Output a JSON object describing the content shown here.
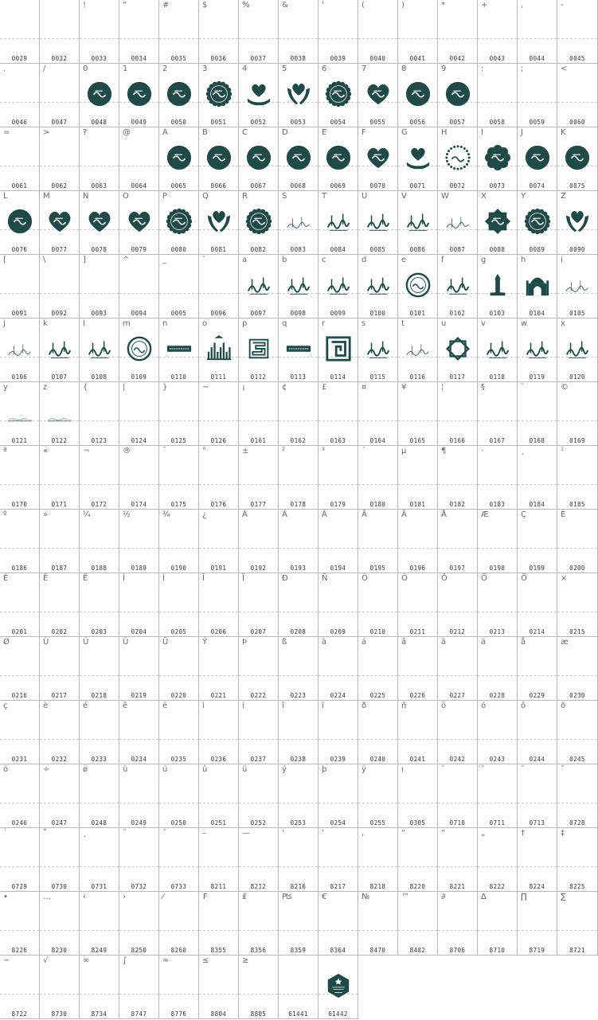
{
  "colors": {
    "glyph": "#1f4a47",
    "border": "#b8b8b8",
    "baseline": "#c8c8c8"
  },
  "cells": [
    {
      "ch": "",
      "code": "0029"
    },
    {
      "ch": "",
      "code": "0032"
    },
    {
      "ch": "!",
      "code": "0033"
    },
    {
      "ch": "\"",
      "code": "0034"
    },
    {
      "ch": "#",
      "code": "0035"
    },
    {
      "ch": "$",
      "code": "0036"
    },
    {
      "ch": "%",
      "code": "0037"
    },
    {
      "ch": "&",
      "code": "0038"
    },
    {
      "ch": "'",
      "code": "0039"
    },
    {
      "ch": "(",
      "code": "0040"
    },
    {
      "ch": ")",
      "code": "0041"
    },
    {
      "ch": "*",
      "code": "0042"
    },
    {
      "ch": "+",
      "code": "0043"
    },
    {
      "ch": ",",
      "code": "0044"
    },
    {
      "ch": "-",
      "code": "0045"
    },
    {
      "ch": ".",
      "code": "0046"
    },
    {
      "ch": "/",
      "code": "0047"
    },
    {
      "ch": "0",
      "code": "0048",
      "icon": "circle"
    },
    {
      "ch": "1",
      "code": "0049",
      "icon": "circle"
    },
    {
      "ch": "2",
      "code": "0050",
      "icon": "circle"
    },
    {
      "ch": "3",
      "code": "0051",
      "icon": "rosette"
    },
    {
      "ch": "4",
      "code": "0052",
      "icon": "hand-heart"
    },
    {
      "ch": "5",
      "code": "0053",
      "icon": "hands-heart"
    },
    {
      "ch": "6",
      "code": "0054",
      "icon": "rosette"
    },
    {
      "ch": "7",
      "code": "0055",
      "icon": "heart"
    },
    {
      "ch": "8",
      "code": "0056",
      "icon": "circle"
    },
    {
      "ch": "9",
      "code": "0057",
      "icon": "circle"
    },
    {
      "ch": ":",
      "code": "0058"
    },
    {
      "ch": ";",
      "code": "0059"
    },
    {
      "ch": "<",
      "code": "0060"
    },
    {
      "ch": "=",
      "code": "0061"
    },
    {
      "ch": ">",
      "code": "0062"
    },
    {
      "ch": "?",
      "code": "0063"
    },
    {
      "ch": "@",
      "code": "0064"
    },
    {
      "ch": "A",
      "code": "0065",
      "icon": "circle"
    },
    {
      "ch": "B",
      "code": "0066",
      "icon": "circle"
    },
    {
      "ch": "C",
      "code": "0067",
      "icon": "circle"
    },
    {
      "ch": "D",
      "code": "0068",
      "icon": "circle"
    },
    {
      "ch": "E",
      "code": "0069",
      "icon": "circle"
    },
    {
      "ch": "F",
      "code": "0070",
      "icon": "heart"
    },
    {
      "ch": "G",
      "code": "0071",
      "icon": "hand-heart"
    },
    {
      "ch": "H",
      "code": "0072",
      "icon": "dotted-circle"
    },
    {
      "ch": "I",
      "code": "0073",
      "icon": "flower"
    },
    {
      "ch": "J",
      "code": "0074",
      "icon": "circle"
    },
    {
      "ch": "K",
      "code": "0075",
      "icon": "circle"
    },
    {
      "ch": "L",
      "code": "0076",
      "icon": "circle"
    },
    {
      "ch": "M",
      "code": "0077",
      "icon": "heart"
    },
    {
      "ch": "N",
      "code": "0078",
      "icon": "heart"
    },
    {
      "ch": "O",
      "code": "0079",
      "icon": "heart"
    },
    {
      "ch": "P",
      "code": "0080",
      "icon": "rosette"
    },
    {
      "ch": "Q",
      "code": "0081",
      "icon": "hands-heart"
    },
    {
      "ch": "R",
      "code": "0082",
      "icon": "rosette"
    },
    {
      "ch": "S",
      "code": "0083",
      "icon": "script-light"
    },
    {
      "ch": "T",
      "code": "0084",
      "icon": "script"
    },
    {
      "ch": "U",
      "code": "0085",
      "icon": "script"
    },
    {
      "ch": "V",
      "code": "0086",
      "icon": "script"
    },
    {
      "ch": "W",
      "code": "0087",
      "icon": "script-light"
    },
    {
      "ch": "X",
      "code": "0088",
      "icon": "star8"
    },
    {
      "ch": "Y",
      "code": "0089",
      "icon": "rosette"
    },
    {
      "ch": "Z",
      "code": "0090",
      "icon": "hands-heart"
    },
    {
      "ch": "[",
      "code": "0091"
    },
    {
      "ch": "\\",
      "code": "0092"
    },
    {
      "ch": "]",
      "code": "0093"
    },
    {
      "ch": "^",
      "code": "0094"
    },
    {
      "ch": "_",
      "code": "0095"
    },
    {
      "ch": "`",
      "code": "0096"
    },
    {
      "ch": "a",
      "code": "0097",
      "icon": "script"
    },
    {
      "ch": "b",
      "code": "0098",
      "icon": "script"
    },
    {
      "ch": "c",
      "code": "0099",
      "icon": "script"
    },
    {
      "ch": "d",
      "code": "0100",
      "icon": "script"
    },
    {
      "ch": "e",
      "code": "0101",
      "icon": "ring"
    },
    {
      "ch": "f",
      "code": "0102",
      "icon": "script"
    },
    {
      "ch": "g",
      "code": "0103",
      "icon": "minaret"
    },
    {
      "ch": "h",
      "code": "0104",
      "icon": "mosque"
    },
    {
      "ch": "i",
      "code": "0105",
      "icon": "script-light"
    },
    {
      "ch": "j",
      "code": "0106",
      "icon": "script-light"
    },
    {
      "ch": "k",
      "code": "0107",
      "icon": "script"
    },
    {
      "ch": "l",
      "code": "0108",
      "icon": "script"
    },
    {
      "ch": "m",
      "code": "0109",
      "icon": "ring"
    },
    {
      "ch": "n",
      "code": "0110",
      "icon": "banner"
    },
    {
      "ch": "o",
      "code": "0111",
      "icon": "kufic-bars"
    },
    {
      "ch": "p",
      "code": "0112",
      "icon": "kufic-square"
    },
    {
      "ch": "q",
      "code": "0113",
      "icon": "banner"
    },
    {
      "ch": "r",
      "code": "0114",
      "icon": "kufic-maze"
    },
    {
      "ch": "s",
      "code": "0115",
      "icon": "script"
    },
    {
      "ch": "t",
      "code": "0116",
      "icon": "script-light"
    },
    {
      "ch": "u",
      "code": "0117",
      "icon": "star-frame"
    },
    {
      "ch": "v",
      "code": "0118",
      "icon": "script"
    },
    {
      "ch": "w",
      "code": "0119",
      "icon": "script"
    },
    {
      "ch": "x",
      "code": "0120",
      "icon": "script"
    },
    {
      "ch": "y",
      "code": "0121",
      "icon": "faint"
    },
    {
      "ch": "z",
      "code": "0122",
      "icon": "faint"
    },
    {
      "ch": "{",
      "code": "0123"
    },
    {
      "ch": "|",
      "code": "0124"
    },
    {
      "ch": "}",
      "code": "0125"
    },
    {
      "ch": "~",
      "code": "0126"
    },
    {
      "ch": "¡",
      "code": "0161"
    },
    {
      "ch": "¢",
      "code": "0162"
    },
    {
      "ch": "£",
      "code": "0163"
    },
    {
      "ch": "¤",
      "code": "0164"
    },
    {
      "ch": "¥",
      "code": "0165"
    },
    {
      "ch": "¦",
      "code": "0166"
    },
    {
      "ch": "§",
      "code": "0167"
    },
    {
      "ch": "¨",
      "code": "0168"
    },
    {
      "ch": "©",
      "code": "0169"
    },
    {
      "ch": "ª",
      "code": "0170"
    },
    {
      "ch": "«",
      "code": "0171"
    },
    {
      "ch": "¬",
      "code": "0172"
    },
    {
      "ch": "®",
      "code": "0174"
    },
    {
      "ch": "¯",
      "code": "0175"
    },
    {
      "ch": "°",
      "code": "0176"
    },
    {
      "ch": "±",
      "code": "0177"
    },
    {
      "ch": "²",
      "code": "0178"
    },
    {
      "ch": "³",
      "code": "0179"
    },
    {
      "ch": "´",
      "code": "0180"
    },
    {
      "ch": "µ",
      "code": "0181"
    },
    {
      "ch": "¶",
      "code": "0182"
    },
    {
      "ch": "·",
      "code": "0183"
    },
    {
      "ch": "¸",
      "code": "0184"
    },
    {
      "ch": "¹",
      "code": "0185"
    },
    {
      "ch": "º",
      "code": "0186"
    },
    {
      "ch": "»",
      "code": "0187"
    },
    {
      "ch": "¼",
      "code": "0188"
    },
    {
      "ch": "½",
      "code": "0189"
    },
    {
      "ch": "¾",
      "code": "0190"
    },
    {
      "ch": "¿",
      "code": "0191"
    },
    {
      "ch": "À",
      "code": "0192"
    },
    {
      "ch": "Á",
      "code": "0193"
    },
    {
      "ch": "Â",
      "code": "0194"
    },
    {
      "ch": "Ã",
      "code": "0195"
    },
    {
      "ch": "Ä",
      "code": "0196"
    },
    {
      "ch": "Å",
      "code": "0197"
    },
    {
      "ch": "Æ",
      "code": "0198"
    },
    {
      "ch": "Ç",
      "code": "0199"
    },
    {
      "ch": "È",
      "code": "0200"
    },
    {
      "ch": "É",
      "code": "0201"
    },
    {
      "ch": "Ê",
      "code": "0202"
    },
    {
      "ch": "Ë",
      "code": "0203"
    },
    {
      "ch": "Ì",
      "code": "0204"
    },
    {
      "ch": "Í",
      "code": "0205"
    },
    {
      "ch": "Î",
      "code": "0206"
    },
    {
      "ch": "Ï",
      "code": "0207"
    },
    {
      "ch": "Ð",
      "code": "0208"
    },
    {
      "ch": "Ñ",
      "code": "0209"
    },
    {
      "ch": "Ò",
      "code": "0210"
    },
    {
      "ch": "Ó",
      "code": "0211"
    },
    {
      "ch": "Ô",
      "code": "0212"
    },
    {
      "ch": "Õ",
      "code": "0213"
    },
    {
      "ch": "Ö",
      "code": "0214"
    },
    {
      "ch": "×",
      "code": "0215"
    },
    {
      "ch": "Ø",
      "code": "0216"
    },
    {
      "ch": "Ù",
      "code": "0217"
    },
    {
      "ch": "Ú",
      "code": "0218"
    },
    {
      "ch": "Û",
      "code": "0219"
    },
    {
      "ch": "Ü",
      "code": "0220"
    },
    {
      "ch": "Ý",
      "code": "0221"
    },
    {
      "ch": "Þ",
      "code": "0222"
    },
    {
      "ch": "ß",
      "code": "0223"
    },
    {
      "ch": "à",
      "code": "0224"
    },
    {
      "ch": "á",
      "code": "0225"
    },
    {
      "ch": "â",
      "code": "0226"
    },
    {
      "ch": "ã",
      "code": "0227"
    },
    {
      "ch": "ä",
      "code": "0228"
    },
    {
      "ch": "å",
      "code": "0229"
    },
    {
      "ch": "æ",
      "code": "0230"
    },
    {
      "ch": "ç",
      "code": "0231"
    },
    {
      "ch": "è",
      "code": "0232"
    },
    {
      "ch": "é",
      "code": "0233"
    },
    {
      "ch": "ê",
      "code": "0234"
    },
    {
      "ch": "ë",
      "code": "0235"
    },
    {
      "ch": "ì",
      "code": "0236"
    },
    {
      "ch": "í",
      "code": "0237"
    },
    {
      "ch": "î",
      "code": "0238"
    },
    {
      "ch": "ï",
      "code": "0239"
    },
    {
      "ch": "ð",
      "code": "0240"
    },
    {
      "ch": "ñ",
      "code": "0241"
    },
    {
      "ch": "ò",
      "code": "0242"
    },
    {
      "ch": "ó",
      "code": "0243"
    },
    {
      "ch": "ô",
      "code": "0244"
    },
    {
      "ch": "õ",
      "code": "0245"
    },
    {
      "ch": "ö",
      "code": "0246"
    },
    {
      "ch": "÷",
      "code": "0247"
    },
    {
      "ch": "ø",
      "code": "0248"
    },
    {
      "ch": "ù",
      "code": "0249"
    },
    {
      "ch": "ú",
      "code": "0250"
    },
    {
      "ch": "û",
      "code": "0251"
    },
    {
      "ch": "ü",
      "code": "0252"
    },
    {
      "ch": "ý",
      "code": "0253"
    },
    {
      "ch": "þ",
      "code": "0254"
    },
    {
      "ch": "ÿ",
      "code": "0255"
    },
    {
      "ch": "ı",
      "code": "0305"
    },
    {
      "ch": "ˆ",
      "code": "0710"
    },
    {
      "ch": "ˇ",
      "code": "0711"
    },
    {
      "ch": "ˉ",
      "code": "0713"
    },
    {
      "ch": "˘",
      "code": "0728"
    },
    {
      "ch": "˙",
      "code": "0729"
    },
    {
      "ch": "˚",
      "code": "0730"
    },
    {
      "ch": "˛",
      "code": "0731"
    },
    {
      "ch": "˜",
      "code": "0732"
    },
    {
      "ch": "˝",
      "code": "0733"
    },
    {
      "ch": "–",
      "code": "8211"
    },
    {
      "ch": "—",
      "code": "8212"
    },
    {
      "ch": "‘",
      "code": "8216"
    },
    {
      "ch": "’",
      "code": "8217"
    },
    {
      "ch": "‚",
      "code": "8218"
    },
    {
      "ch": "“",
      "code": "8220"
    },
    {
      "ch": "”",
      "code": "8221"
    },
    {
      "ch": "„",
      "code": "8222"
    },
    {
      "ch": "†",
      "code": "8224"
    },
    {
      "ch": "‡",
      "code": "8225"
    },
    {
      "ch": "•",
      "code": "8226"
    },
    {
      "ch": "…",
      "code": "8230"
    },
    {
      "ch": "‹",
      "code": "8249"
    },
    {
      "ch": "›",
      "code": "8250"
    },
    {
      "ch": "⁄",
      "code": "8260"
    },
    {
      "ch": "₣",
      "code": "8355"
    },
    {
      "ch": "₤",
      "code": "8356"
    },
    {
      "ch": "₧",
      "code": "8359"
    },
    {
      "ch": "€",
      "code": "8364"
    },
    {
      "ch": "№",
      "code": "8470"
    },
    {
      "ch": "™",
      "code": "8482"
    },
    {
      "ch": "∂",
      "code": "8706"
    },
    {
      "ch": "∆",
      "code": "8710"
    },
    {
      "ch": "∏",
      "code": "8719"
    },
    {
      "ch": "∑",
      "code": "8721"
    },
    {
      "ch": "−",
      "code": "8722"
    },
    {
      "ch": "√",
      "code": "8730"
    },
    {
      "ch": "∞",
      "code": "8734"
    },
    {
      "ch": "∫",
      "code": "8747"
    },
    {
      "ch": "≈",
      "code": "8776"
    },
    {
      "ch": "≤",
      "code": "8804"
    },
    {
      "ch": "≥",
      "code": "8805"
    },
    {
      "ch": "",
      "code": "61441"
    },
    {
      "ch": "",
      "code": "61442",
      "icon": "hexagon-badge"
    }
  ]
}
